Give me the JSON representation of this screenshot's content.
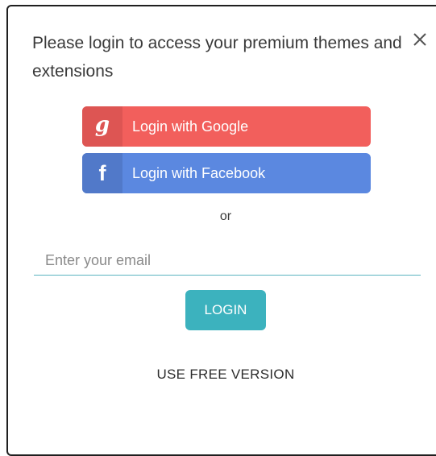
{
  "dialog": {
    "title": "Please login to access your premium themes and extensions",
    "close_icon": "close-icon"
  },
  "social": {
    "google": {
      "icon": "g",
      "label": "Login with Google",
      "color": "#f25f5c"
    },
    "facebook": {
      "icon": "f",
      "label": "Login with Facebook",
      "color": "#5b88e0"
    }
  },
  "separator": {
    "text": "or"
  },
  "email": {
    "placeholder": "Enter your email",
    "value": ""
  },
  "login_button": {
    "label": "LOGIN",
    "color": "#3cb2be"
  },
  "free_version": {
    "label": "USE FREE VERSION"
  }
}
